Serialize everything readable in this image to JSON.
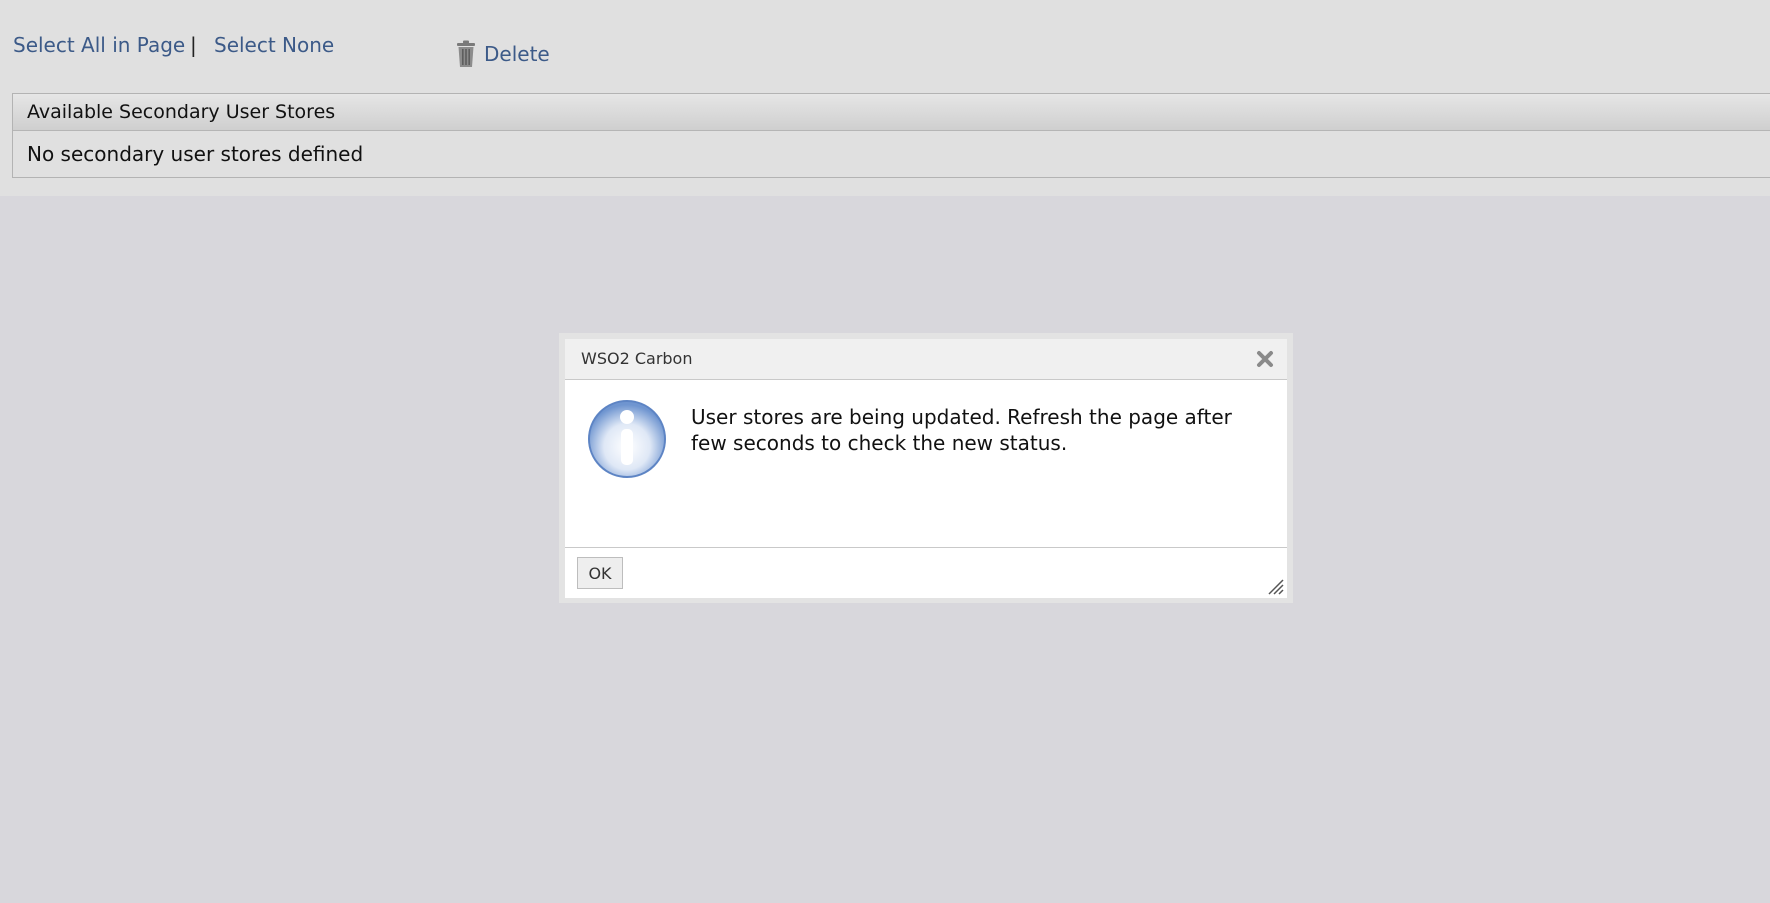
{
  "toolbar": {
    "select_all_label": "Select All in Page",
    "separator": "|",
    "select_none_label": "Select None",
    "delete_label": "Delete",
    "delete_icon": "trash-icon",
    "link_color": "#3c5a88"
  },
  "table": {
    "header": "Available Secondary User Stores",
    "empty_message": "No secondary user stores defined"
  },
  "dialog": {
    "title": "WSO2 Carbon",
    "close_icon": "close-icon",
    "info_icon": "info-icon",
    "message": "User stores are being updated. Refresh the page after few seconds to check the new status.",
    "ok_label": "OK",
    "resize_icon": "resize-grip-icon"
  }
}
